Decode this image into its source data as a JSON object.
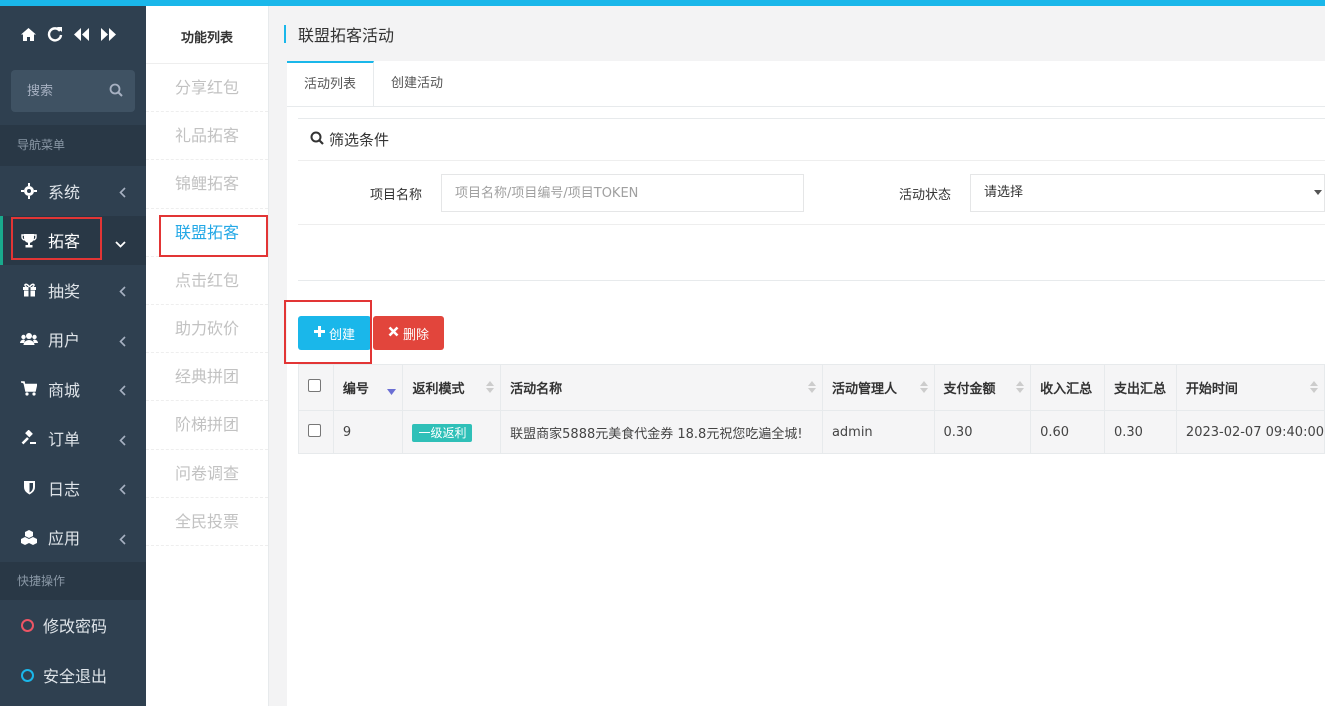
{
  "colors": {
    "accent": "#1ab7ea",
    "sidebar": "#2f4050",
    "danger": "#e2453c",
    "badge": "#2fc0b8",
    "highlight": "#e23535"
  },
  "sidebar": {
    "search_placeholder": "搜索",
    "nav_section": "导航菜单",
    "items": [
      {
        "label": "系统",
        "icon": "gear-icon"
      },
      {
        "label": "拓客",
        "icon": "trophy-icon"
      },
      {
        "label": "抽奖",
        "icon": "gift-icon"
      },
      {
        "label": "用户",
        "icon": "users-icon"
      },
      {
        "label": "商城",
        "icon": "cart-icon"
      },
      {
        "label": "订单",
        "icon": "gavel-icon"
      },
      {
        "label": "日志",
        "icon": "shield-icon"
      },
      {
        "label": "应用",
        "icon": "cubes-icon"
      }
    ],
    "quick_section": "快捷操作",
    "quick": [
      {
        "label": "修改密码"
      },
      {
        "label": "安全退出"
      }
    ]
  },
  "funclist": {
    "title": "功能列表",
    "items": [
      "分享红包",
      "礼品拓客",
      "锦鲤拓客",
      "联盟拓客",
      "点击红包",
      "助力砍价",
      "经典拼团",
      "阶梯拼团",
      "问卷调查",
      "全民投票"
    ],
    "active": "联盟拓客"
  },
  "page": {
    "title": "联盟拓客活动",
    "tabs": [
      "活动列表",
      "创建活动"
    ],
    "filter": {
      "heading": "筛选条件",
      "project_label": "项目名称",
      "project_placeholder": "项目名称/项目编号/项目TOKEN",
      "status_label": "活动状态",
      "status_value": "请选择"
    },
    "buttons": {
      "create": "创建",
      "delete": "删除"
    },
    "table": {
      "headers": [
        "编号",
        "返利模式",
        "活动名称",
        "活动管理人",
        "支付金额",
        "收入汇总",
        "支出汇总",
        "开始时间"
      ],
      "rows": [
        {
          "id": "9",
          "mode": "一级返利",
          "name": "联盟商家5888元美食代金券 18.8元祝您吃遍全城!",
          "manager": "admin",
          "pay": "0.30",
          "income": "0.60",
          "expense": "0.30",
          "start": "2023-02-07 09:40:00"
        }
      ]
    }
  }
}
